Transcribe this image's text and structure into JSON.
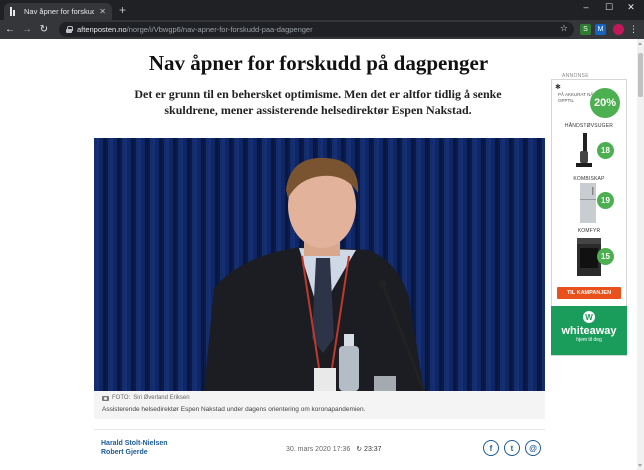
{
  "browser": {
    "tab_title": "Nav åpner for forskudd på dagpe",
    "url_host": "aftenposten.no",
    "url_path": "/norge/i/Vbwgp6/nav-apner-for-forskudd-paa-dagpenger",
    "ext_labels": [
      "S",
      "M"
    ]
  },
  "article": {
    "headline": "Nav åpner for forskudd på dagpenger",
    "lede": "Det er grunn til en behersket optimisme. Men det er altfor tidlig å senke skuldrene, mener assisterende helsedirektør Espen Nakstad.",
    "photo_credit_label": "FOTO:",
    "photo_credit": "Siri Øverland Eriksen",
    "caption": "Assisterende helsedirektør Espen Nakstad under dagens orientering om koronapandemien.",
    "authors": [
      "Harald Stolt-Nielsen",
      "Robert Gjerde"
    ],
    "published": "30. mars 2020 17:36",
    "updated": "23:37"
  },
  "ad": {
    "label": "ANNONSE",
    "top_text": "PÅ AKKURAT NÅ OPPTIL",
    "top_percent": "20%",
    "products": [
      {
        "name": "HÅNDSTØVSUGER",
        "percent": "18"
      },
      {
        "name": "KOMBISKAP",
        "percent": "19"
      },
      {
        "name": "KOMFYR",
        "percent": "15"
      }
    ],
    "cta": "TIL KAMPANJEN",
    "brand": "whiteaway",
    "brand_letter": "W",
    "brand_tagline": "hjem til deg"
  },
  "colors": {
    "chrome_dark": "#202124",
    "accent_blue": "#1b5a96",
    "ad_green": "#1a9c5b",
    "cta_orange": "#e8511c"
  }
}
